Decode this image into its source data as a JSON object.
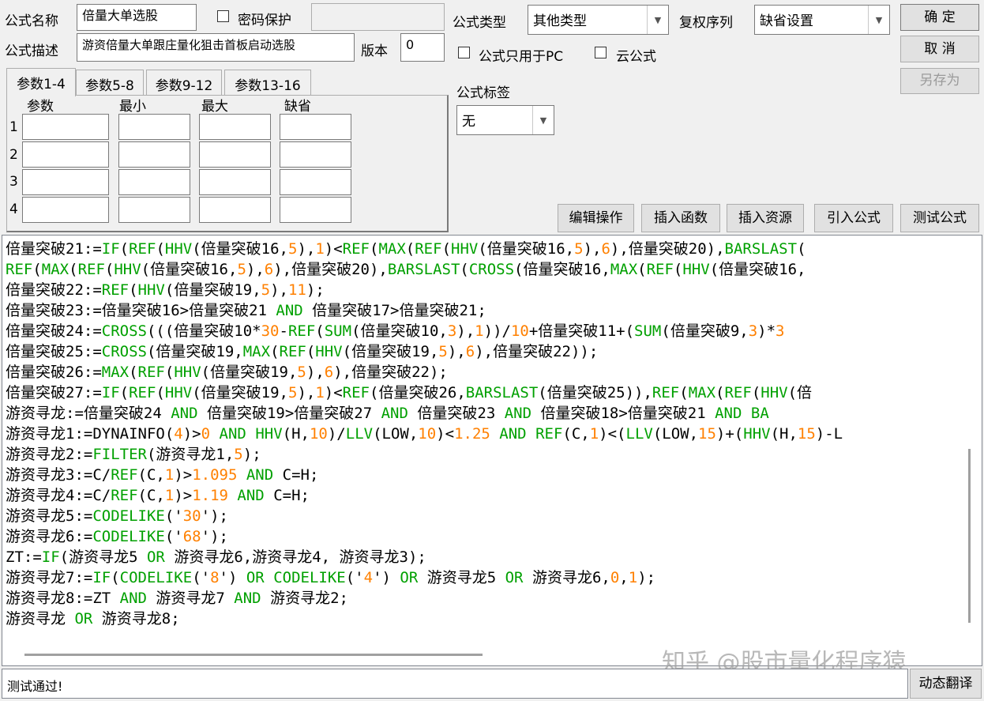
{
  "form": {
    "name_label": "公式名称",
    "name_value": "倍量大单选股",
    "password_label": "密码保护",
    "password_checked": false,
    "password_value": "",
    "desc_label": "公式描述",
    "desc_value": "游资倍量大单跟庄量化狙击首板启动选股",
    "version_label": "版本",
    "version_value": "0",
    "type_label": "公式类型",
    "type_value": "其他类型",
    "rights_label": "复权序列",
    "rights_value": "缺省设置",
    "pc_only_label": "公式只用于PC",
    "pc_only_checked": false,
    "cloud_label": "云公式",
    "cloud_checked": false,
    "tag_label": "公式标签",
    "tag_value": "无"
  },
  "buttons": {
    "ok": "确  定",
    "cancel": "取  消",
    "save_as": "另存为",
    "edit_ops": "编辑操作",
    "insert_func": "插入函数",
    "insert_res": "插入资源",
    "import_formula": "引入公式",
    "test_formula": "测试公式",
    "dyn_translate": "动态翻译"
  },
  "param_tabs": [
    "参数1-4",
    "参数5-8",
    "参数9-12",
    "参数13-16"
  ],
  "param_headers": [
    "参数",
    "最小",
    "最大",
    "缺省"
  ],
  "param_rows": [
    "1",
    "2",
    "3",
    "4"
  ],
  "colors": {
    "keyword": "#00a000",
    "number": "#ff8000",
    "text": "#000000"
  },
  "code_lines": [
    [
      [
        "t",
        "倍量突破21:="
      ],
      [
        "k",
        "IF"
      ],
      [
        "t",
        "("
      ],
      [
        "k",
        "REF"
      ],
      [
        "t",
        "("
      ],
      [
        "k",
        "HHV"
      ],
      [
        "t",
        "(倍量突破16,"
      ],
      [
        "n",
        "5"
      ],
      [
        "t",
        "),"
      ],
      [
        "n",
        "1"
      ],
      [
        "t",
        ")<"
      ],
      [
        "k",
        "REF"
      ],
      [
        "t",
        "("
      ],
      [
        "k",
        "MAX"
      ],
      [
        "t",
        "("
      ],
      [
        "k",
        "REF"
      ],
      [
        "t",
        "("
      ],
      [
        "k",
        "HHV"
      ],
      [
        "t",
        "(倍量突破16,"
      ],
      [
        "n",
        "5"
      ],
      [
        "t",
        "),"
      ],
      [
        "n",
        "6"
      ],
      [
        "t",
        "),倍量突破20),"
      ],
      [
        "k",
        "BARSLAST"
      ],
      [
        "t",
        "("
      ]
    ],
    [
      [
        "k",
        "REF"
      ],
      [
        "t",
        "("
      ],
      [
        "k",
        "MAX"
      ],
      [
        "t",
        "("
      ],
      [
        "k",
        "REF"
      ],
      [
        "t",
        "("
      ],
      [
        "k",
        "HHV"
      ],
      [
        "t",
        "(倍量突破16,"
      ],
      [
        "n",
        "5"
      ],
      [
        "t",
        "),"
      ],
      [
        "n",
        "6"
      ],
      [
        "t",
        "),倍量突破20),"
      ],
      [
        "k",
        "BARSLAST"
      ],
      [
        "t",
        "("
      ],
      [
        "k",
        "CROSS"
      ],
      [
        "t",
        "(倍量突破16,"
      ],
      [
        "k",
        "MAX"
      ],
      [
        "t",
        "("
      ],
      [
        "k",
        "REF"
      ],
      [
        "t",
        "("
      ],
      [
        "k",
        "HHV"
      ],
      [
        "t",
        "(倍量突破16,"
      ]
    ],
    [
      [
        "t",
        "倍量突破22:="
      ],
      [
        "k",
        "REF"
      ],
      [
        "t",
        "("
      ],
      [
        "k",
        "HHV"
      ],
      [
        "t",
        "(倍量突破19,"
      ],
      [
        "n",
        "5"
      ],
      [
        "t",
        "),"
      ],
      [
        "n",
        "11"
      ],
      [
        "t",
        ");"
      ]
    ],
    [
      [
        "t",
        "倍量突破23:=倍量突破16>倍量突破21 "
      ],
      [
        "k",
        "AND"
      ],
      [
        "t",
        " 倍量突破17>倍量突破21;"
      ]
    ],
    [
      [
        "t",
        "倍量突破24:="
      ],
      [
        "k",
        "CROSS"
      ],
      [
        "t",
        "(((倍量突破10*"
      ],
      [
        "n",
        "30"
      ],
      [
        "t",
        "-"
      ],
      [
        "k",
        "REF"
      ],
      [
        "t",
        "("
      ],
      [
        "k",
        "SUM"
      ],
      [
        "t",
        "(倍量突破10,"
      ],
      [
        "n",
        "3"
      ],
      [
        "t",
        "),"
      ],
      [
        "n",
        "1"
      ],
      [
        "t",
        "))/"
      ],
      [
        "n",
        "10"
      ],
      [
        "t",
        "+倍量突破11+("
      ],
      [
        "k",
        "SUM"
      ],
      [
        "t",
        "(倍量突破9,"
      ],
      [
        "n",
        "3"
      ],
      [
        "t",
        ")*"
      ],
      [
        "n",
        "3"
      ]
    ],
    [
      [
        "t",
        "倍量突破25:="
      ],
      [
        "k",
        "CROSS"
      ],
      [
        "t",
        "(倍量突破19,"
      ],
      [
        "k",
        "MAX"
      ],
      [
        "t",
        "("
      ],
      [
        "k",
        "REF"
      ],
      [
        "t",
        "("
      ],
      [
        "k",
        "HHV"
      ],
      [
        "t",
        "(倍量突破19,"
      ],
      [
        "n",
        "5"
      ],
      [
        "t",
        "),"
      ],
      [
        "n",
        "6"
      ],
      [
        "t",
        "),倍量突破22));"
      ]
    ],
    [
      [
        "t",
        "倍量突破26:="
      ],
      [
        "k",
        "MAX"
      ],
      [
        "t",
        "("
      ],
      [
        "k",
        "REF"
      ],
      [
        "t",
        "("
      ],
      [
        "k",
        "HHV"
      ],
      [
        "t",
        "(倍量突破19,"
      ],
      [
        "n",
        "5"
      ],
      [
        "t",
        "),"
      ],
      [
        "n",
        "6"
      ],
      [
        "t",
        "),倍量突破22);"
      ]
    ],
    [
      [
        "t",
        "倍量突破27:="
      ],
      [
        "k",
        "IF"
      ],
      [
        "t",
        "("
      ],
      [
        "k",
        "REF"
      ],
      [
        "t",
        "("
      ],
      [
        "k",
        "HHV"
      ],
      [
        "t",
        "(倍量突破19,"
      ],
      [
        "n",
        "5"
      ],
      [
        "t",
        "),"
      ],
      [
        "n",
        "1"
      ],
      [
        "t",
        ")<"
      ],
      [
        "k",
        "REF"
      ],
      [
        "t",
        "(倍量突破26,"
      ],
      [
        "k",
        "BARSLAST"
      ],
      [
        "t",
        "(倍量突破25)),"
      ],
      [
        "k",
        "REF"
      ],
      [
        "t",
        "("
      ],
      [
        "k",
        "MAX"
      ],
      [
        "t",
        "("
      ],
      [
        "k",
        "REF"
      ],
      [
        "t",
        "("
      ],
      [
        "k",
        "HHV"
      ],
      [
        "t",
        "(倍"
      ]
    ],
    [
      [
        "t",
        "游资寻龙:=倍量突破24 "
      ],
      [
        "k",
        "AND"
      ],
      [
        "t",
        " 倍量突破19>倍量突破27 "
      ],
      [
        "k",
        "AND"
      ],
      [
        "t",
        " 倍量突破23 "
      ],
      [
        "k",
        "AND"
      ],
      [
        "t",
        " 倍量突破18>倍量突破21 "
      ],
      [
        "k",
        "AND"
      ],
      [
        "t",
        " "
      ],
      [
        "k",
        "BA"
      ]
    ],
    [
      [
        "t",
        "游资寻龙1:=DYNAINFO("
      ],
      [
        "n",
        "4"
      ],
      [
        "t",
        ")>"
      ],
      [
        "n",
        "0"
      ],
      [
        "t",
        " "
      ],
      [
        "k",
        "AND"
      ],
      [
        "t",
        " "
      ],
      [
        "k",
        "HHV"
      ],
      [
        "t",
        "(H,"
      ],
      [
        "n",
        "10"
      ],
      [
        "t",
        ")/"
      ],
      [
        "k",
        "LLV"
      ],
      [
        "t",
        "(LOW,"
      ],
      [
        "n",
        "10"
      ],
      [
        "t",
        ")<"
      ],
      [
        "n",
        "1.25"
      ],
      [
        "t",
        " "
      ],
      [
        "k",
        "AND"
      ],
      [
        "t",
        " "
      ],
      [
        "k",
        "REF"
      ],
      [
        "t",
        "(C,"
      ],
      [
        "n",
        "1"
      ],
      [
        "t",
        ")<("
      ],
      [
        "k",
        "LLV"
      ],
      [
        "t",
        "(LOW,"
      ],
      [
        "n",
        "15"
      ],
      [
        "t",
        ")+("
      ],
      [
        "k",
        "HHV"
      ],
      [
        "t",
        "(H,"
      ],
      [
        "n",
        "15"
      ],
      [
        "t",
        ")-L"
      ]
    ],
    [
      [
        "t",
        "游资寻龙2:="
      ],
      [
        "k",
        "FILTER"
      ],
      [
        "t",
        "(游资寻龙1,"
      ],
      [
        "n",
        "5"
      ],
      [
        "t",
        ");"
      ]
    ],
    [
      [
        "t",
        "游资寻龙3:=C/"
      ],
      [
        "k",
        "REF"
      ],
      [
        "t",
        "(C,"
      ],
      [
        "n",
        "1"
      ],
      [
        "t",
        ")>"
      ],
      [
        "n",
        "1.095"
      ],
      [
        "t",
        " "
      ],
      [
        "k",
        "AND"
      ],
      [
        "t",
        " C=H;"
      ]
    ],
    [
      [
        "t",
        "游资寻龙4:=C/"
      ],
      [
        "k",
        "REF"
      ],
      [
        "t",
        "(C,"
      ],
      [
        "n",
        "1"
      ],
      [
        "t",
        ")>"
      ],
      [
        "n",
        "1.19"
      ],
      [
        "t",
        " "
      ],
      [
        "k",
        "AND"
      ],
      [
        "t",
        " C=H;"
      ]
    ],
    [
      [
        "t",
        "游资寻龙5:="
      ],
      [
        "k",
        "CODELIKE"
      ],
      [
        "t",
        "('"
      ],
      [
        "n",
        "30"
      ],
      [
        "t",
        "');"
      ]
    ],
    [
      [
        "t",
        "游资寻龙6:="
      ],
      [
        "k",
        "CODELIKE"
      ],
      [
        "t",
        "('"
      ],
      [
        "n",
        "68"
      ],
      [
        "t",
        "');"
      ]
    ],
    [
      [
        "t",
        "ZT:="
      ],
      [
        "k",
        "IF"
      ],
      [
        "t",
        "(游资寻龙5 "
      ],
      [
        "k",
        "OR"
      ],
      [
        "t",
        " 游资寻龙6,游资寻龙4, 游资寻龙3);"
      ]
    ],
    [
      [
        "t",
        "游资寻龙7:="
      ],
      [
        "k",
        "IF"
      ],
      [
        "t",
        "("
      ],
      [
        "k",
        "CODELIKE"
      ],
      [
        "t",
        "('"
      ],
      [
        "n",
        "8"
      ],
      [
        "t",
        "') "
      ],
      [
        "k",
        "OR"
      ],
      [
        "t",
        " "
      ],
      [
        "k",
        "CODELIKE"
      ],
      [
        "t",
        "('"
      ],
      [
        "n",
        "4"
      ],
      [
        "t",
        "') "
      ],
      [
        "k",
        "OR"
      ],
      [
        "t",
        " 游资寻龙5 "
      ],
      [
        "k",
        "OR"
      ],
      [
        "t",
        " 游资寻龙6,"
      ],
      [
        "n",
        "0"
      ],
      [
        "t",
        ","
      ],
      [
        "n",
        "1"
      ],
      [
        "t",
        ");"
      ]
    ],
    [
      [
        "t",
        "游资寻龙8:=ZT "
      ],
      [
        "k",
        "AND"
      ],
      [
        "t",
        " 游资寻龙7 "
      ],
      [
        "k",
        "AND"
      ],
      [
        "t",
        " 游资寻龙2;"
      ]
    ],
    [
      [
        "t",
        "游资寻龙 "
      ],
      [
        "k",
        "OR"
      ],
      [
        "t",
        " 游资寻龙8;"
      ]
    ]
  ],
  "status_text": "测试通过!",
  "watermark": "知乎 @股市量化程序猿"
}
